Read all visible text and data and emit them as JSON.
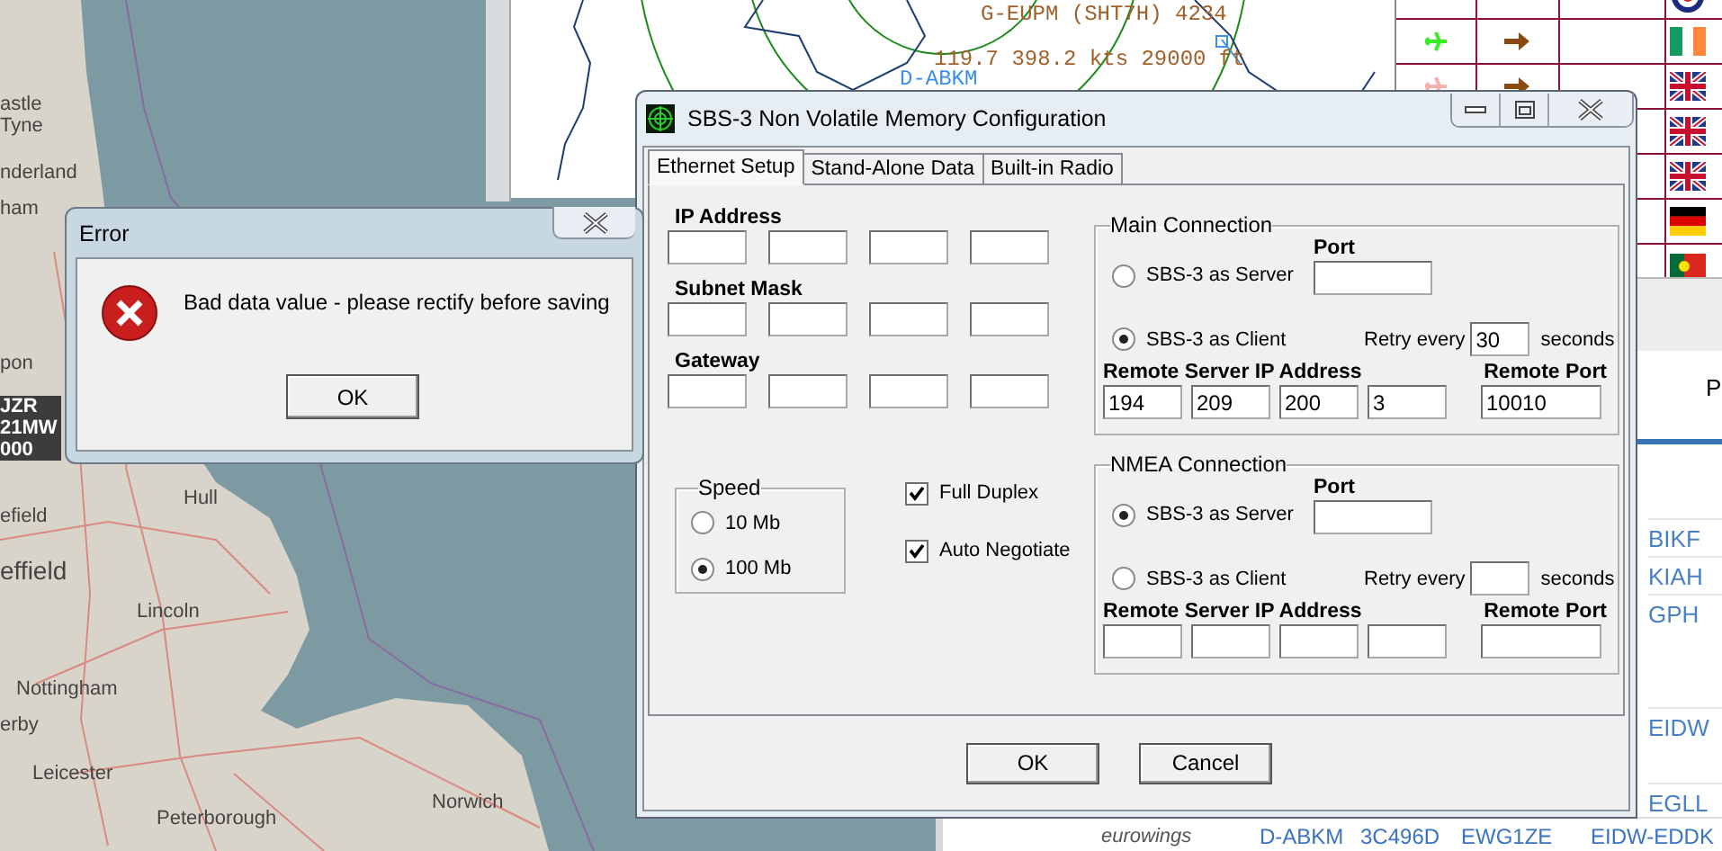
{
  "map": {
    "places": [
      {
        "name": "astle"
      },
      {
        "name": "Tyne"
      },
      {
        "name": "nderland"
      },
      {
        "name": "ham"
      },
      {
        "name": "pon"
      },
      {
        "name": "efield"
      },
      {
        "name": "effield"
      },
      {
        "name": "Hull"
      },
      {
        "name": "Lincoln"
      },
      {
        "name": "Nottingham"
      },
      {
        "name": "erby"
      },
      {
        "name": "Leicester"
      },
      {
        "name": "Peterborough"
      },
      {
        "name": "Norwich"
      }
    ],
    "aircraft_tag": [
      "JZR",
      "21MW",
      "000"
    ]
  },
  "radar": {
    "labels": [
      {
        "text": "G-EUPM (SHT7H) 4234",
        "color": "#a0602a"
      },
      {
        "text": "119.7 398.2 kts 29000 ft",
        "color": "#a0602a"
      },
      {
        "text": "D-ABKM",
        "color": "#3a8ee8"
      }
    ]
  },
  "flight_table": {
    "rows": [
      {
        "color": "#33ee22"
      },
      {
        "color": "#f6b0b0"
      }
    ]
  },
  "flight_list": {
    "header": "P",
    "routes": [
      "BIKF",
      "KIAH",
      "GPH",
      "EIDW",
      "EGLL"
    ],
    "bottom_row": {
      "airline": "eurowings",
      "registration": "D-ABKM",
      "hex": "3C496D",
      "callsign": "EWG1ZE",
      "route": "EIDW-EDDK"
    }
  },
  "config_dialog": {
    "title": "SBS-3 Non Volatile Memory Configuration",
    "tabs": [
      {
        "label": "Ethernet Setup",
        "selected": true
      },
      {
        "label": "Stand-Alone Data",
        "selected": false
      },
      {
        "label": "Built-in Radio",
        "selected": false
      }
    ],
    "address_groups": [
      {
        "label": "IP Address"
      },
      {
        "label": "Subnet Mask"
      },
      {
        "label": "Gateway"
      }
    ],
    "speed": {
      "title": "Speed",
      "options": [
        {
          "label": "10 Mb",
          "selected": false
        },
        {
          "label": "100 Mb",
          "selected": true
        }
      ]
    },
    "checkboxes": [
      {
        "label": "Full Duplex",
        "checked": true
      },
      {
        "label": "Auto Negotiate",
        "checked": true
      }
    ],
    "connections": [
      {
        "title": "Main Connection",
        "port_label": "Port",
        "modes": [
          {
            "label": "SBS-3 as Server",
            "selected": false
          },
          {
            "label": "SBS-3 as Client",
            "selected": true
          }
        ],
        "retry_label": "Retry every",
        "retry_value": "30",
        "retry_unit": "seconds",
        "remote_ip_label": "Remote Server IP Address",
        "remote_ip": [
          "194",
          "209",
          "200",
          "3"
        ],
        "remote_port_label": "Remote Port",
        "remote_port": "10010"
      },
      {
        "title": "NMEA Connection",
        "port_label": "Port",
        "modes": [
          {
            "label": "SBS-3 as Server",
            "selected": true
          },
          {
            "label": "SBS-3 as Client",
            "selected": false
          }
        ],
        "retry_label": "Retry every",
        "retry_unit": "seconds",
        "remote_ip_label": "Remote Server IP Address",
        "remote_port_label": "Remote Port"
      }
    ],
    "buttons": [
      "OK",
      "Cancel"
    ]
  },
  "error_dialog": {
    "title": "Error",
    "message": "Bad data value - please rectify before saving",
    "button": "OK"
  }
}
